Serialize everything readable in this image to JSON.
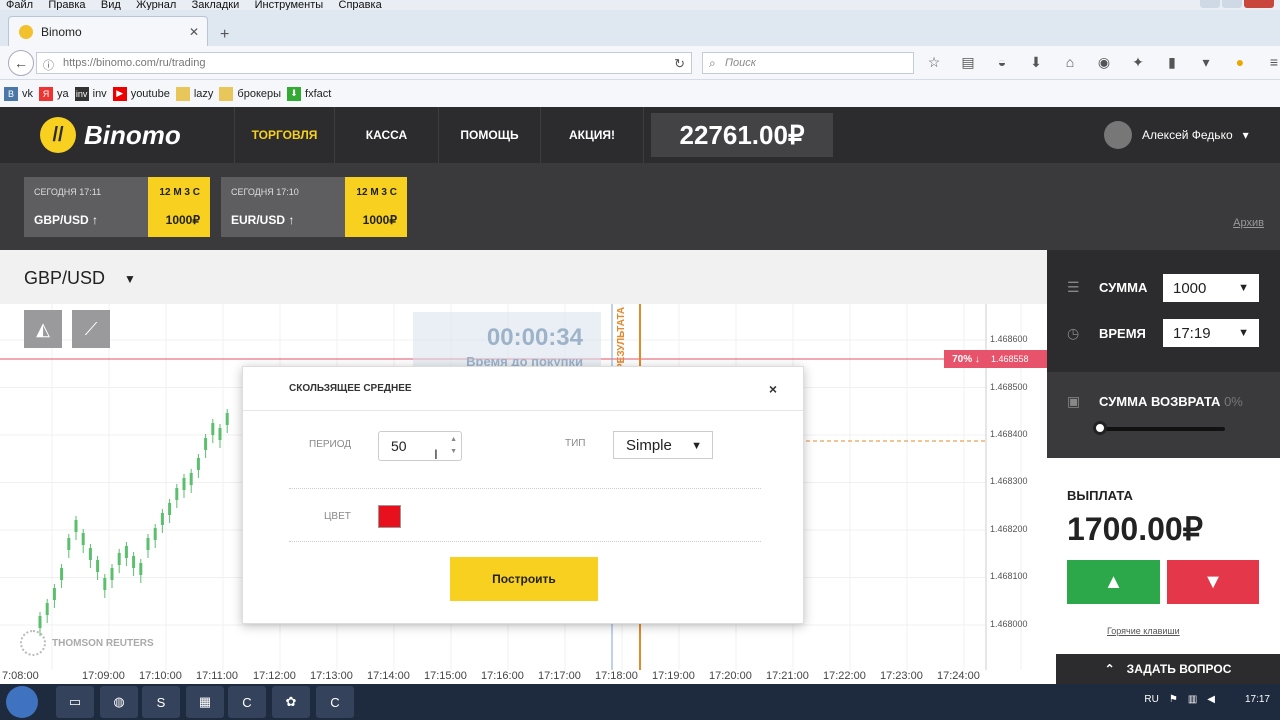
{
  "browser": {
    "menu": [
      "Файл",
      "Правка",
      "Вид",
      "Журнал",
      "Закладки",
      "Инструменты",
      "Справка"
    ],
    "tab_title": "Binomo",
    "url": "https://binomo.com/ru/trading",
    "search_placeholder": "Поиск",
    "bookmarks": [
      {
        "label": "vk",
        "icon": "B",
        "color": "#4a76a8"
      },
      {
        "label": "ya",
        "icon": "Я",
        "color": "#e33"
      },
      {
        "label": "inv",
        "icon": "inv",
        "color": "#333"
      },
      {
        "label": "youtube",
        "icon": "▶",
        "color": "#e00"
      },
      {
        "label": "lazy",
        "icon": "",
        "color": "#e8c65a"
      },
      {
        "label": "брокеры",
        "icon": "",
        "color": "#e8c65a"
      },
      {
        "label": "fxfact",
        "icon": "⬇",
        "color": "#3a3"
      }
    ]
  },
  "header": {
    "logo_text": "Binomo",
    "nav": [
      "ТОРГОВЛЯ",
      "КАССА",
      "ПОМОЩЬ",
      "АКЦИЯ!"
    ],
    "balance": "22761.00₽",
    "user_name": "Алексей Федько"
  },
  "trades": [
    {
      "time": "СЕГОДНЯ 17:11",
      "pair": "GBP/USD ↑",
      "duration": "12 М 3 С",
      "amount": "1000₽"
    },
    {
      "time": "СЕГОДНЯ 17:10",
      "pair": "EUR/USD ↑",
      "duration": "12 М 3 С",
      "amount": "1000₽"
    }
  ],
  "archive_link": "Архив",
  "chart": {
    "pair": "GBP/USD",
    "timer": "00:00:34",
    "timer_label": "Время до покупки",
    "result_label": "РЕЗУЛЬТАТА",
    "provider": "THOMSON REUTERS",
    "percent_badge": "70% ↓",
    "current_price": "1.468558",
    "y_labels": [
      "1.468600",
      "1.468500",
      "1.468400",
      "1.468300",
      "1.468200",
      "1.468100",
      "1.468000"
    ],
    "x_labels": [
      "7:08:00",
      "17:09:00",
      "17:10:00",
      "17:11:00",
      "17:12:00",
      "17:13:00",
      "17:14:00",
      "17:15:00",
      "17:16:00",
      "17:17:00",
      "17:18:00",
      "17:19:00",
      "17:20:00",
      "17:21:00",
      "17:22:00",
      "17:23:00",
      "17:24:00"
    ]
  },
  "panel": {
    "amount_label": "СУММА",
    "amount_value": "1000",
    "time_label": "ВРЕМЯ",
    "time_value": "17:19",
    "return_label": "СУММА ВОЗВРАТА",
    "return_pct": "0%",
    "return_fraction": 0,
    "payout_label": "ВЫПЛАТА",
    "payout_value": "1700.00₽",
    "hotkeys": "Горячие клавиши",
    "ask": "ЗАДАТЬ ВОПРОС"
  },
  "modal": {
    "title": "СКОЛЬЗЯЩЕЕ СРЕДНЕЕ",
    "period_label": "ПЕРИОД",
    "period_value": "50",
    "type_label": "ТИП",
    "type_value": "Simple",
    "color_label": "ЦВЕТ",
    "color_value": "#e8101c",
    "build_button": "Построить"
  },
  "taskbar": {
    "lang": "RU",
    "clock": "17:17"
  }
}
